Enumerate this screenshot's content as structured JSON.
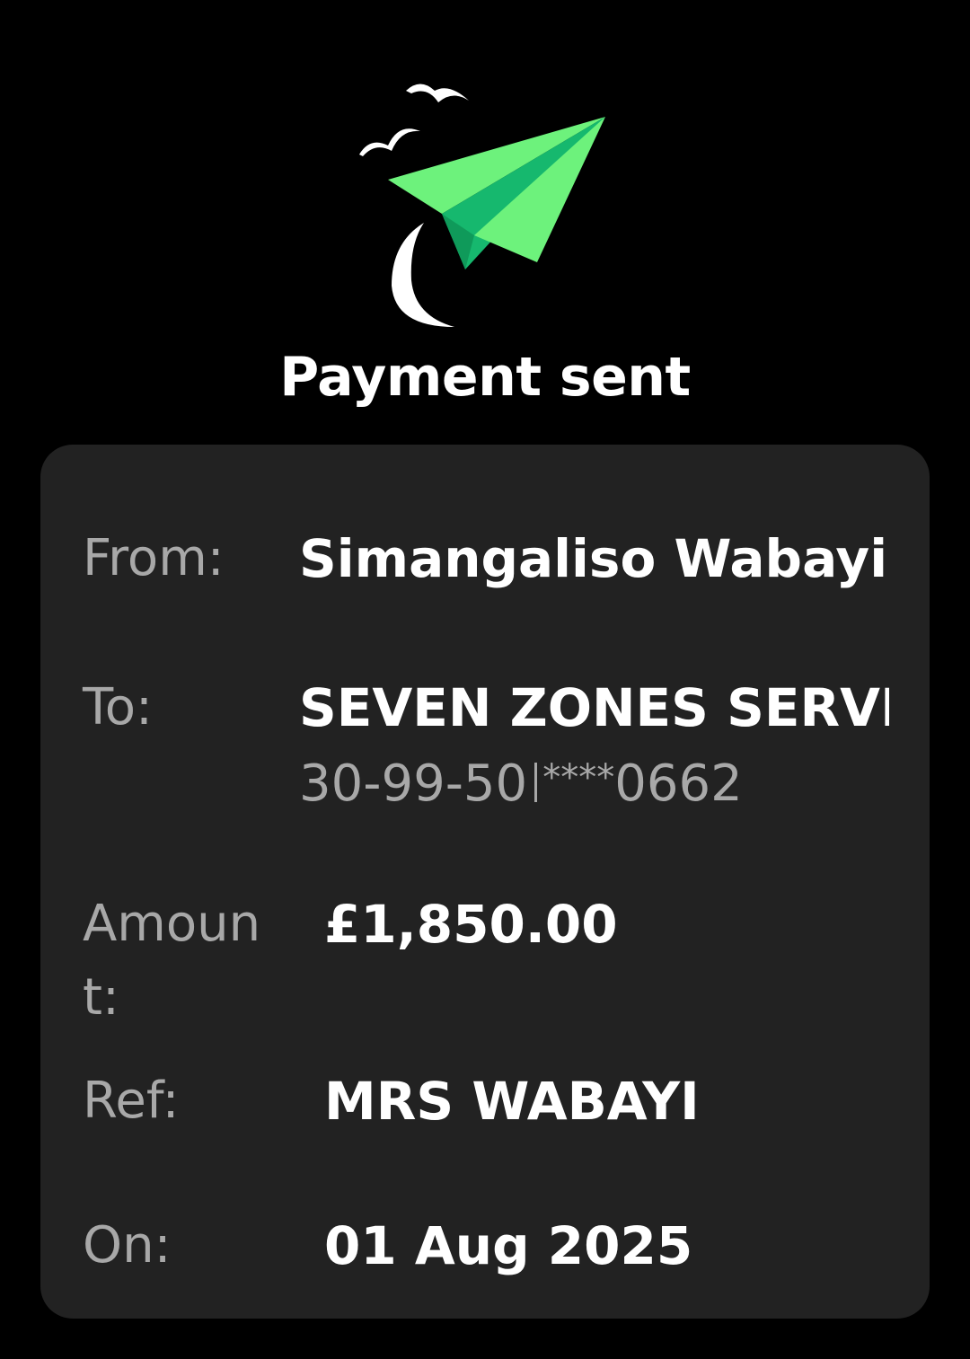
{
  "title": "Payment sent",
  "illustration": {
    "icon": "paper-plane-with-birds-icon",
    "colors": {
      "plane_light": "#6df27c",
      "plane_dark": "#16b86e",
      "birds": "#ffffff"
    }
  },
  "details": {
    "from": {
      "label": "From:",
      "value": "Simangaliso Wabayi"
    },
    "to": {
      "label": "To:",
      "value": "SEVEN ZONES SERVIC",
      "sort_code": "30-99-50",
      "account_mask": "****",
      "account_last4": "0662"
    },
    "amount": {
      "label": "Amount:",
      "value": "£1,850.00"
    },
    "ref": {
      "label": "Ref:",
      "value": "MRS WABAYI"
    },
    "on": {
      "label": "On:",
      "value": "01 Aug 2025"
    }
  },
  "colors": {
    "background": "#000000",
    "card": "#222222",
    "label_text": "#a8a8a8",
    "value_text": "#ffffff"
  }
}
